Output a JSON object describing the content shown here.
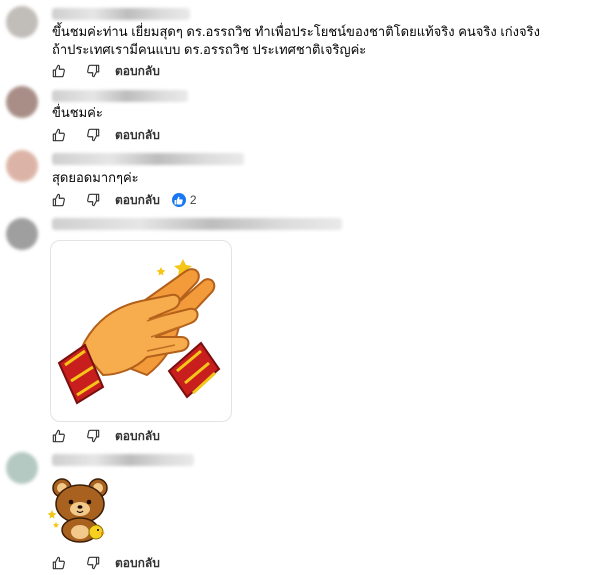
{
  "comments": [
    {
      "lines": [
        "ขึ้นชมค่ะท่าน เยี่ยมสุดๆ ดร.อรรถวิช ทำเพื่อประโยชน์ของชาติโดยแท้จริง คนจริง เก่งจริง",
        "ถ้าประเทศเรามีคนแบบ ดร.อรรถวิช ประเทศชาติเจริญค่ะ"
      ],
      "reply_label": "ตอบกลับ",
      "avatar_color": "#b7b2ad"
    },
    {
      "lines": [
        "ขื่นชมค่ะ"
      ],
      "reply_label": "ตอบกลับ",
      "avatar_color": "#9a7b72"
    },
    {
      "lines": [
        "สุดยอดมากๆค่ะ"
      ],
      "reply_label": "ตอบกลับ",
      "reaction_count": "2",
      "avatar_color": "#d7a898"
    },
    {
      "sticker": "clapping-hands-sticker",
      "reply_label": "ตอบกลับ",
      "avatar_color": "#8f8f8f"
    },
    {
      "sticker": "bear-sticker",
      "reply_label": "ตอบกลับ",
      "avatar_color": "#a8c0b8"
    }
  ],
  "colors": {
    "reaction_blue": "#1877f2",
    "text": "#050505",
    "sticker_orange": "#f0952e",
    "sticker_red": "#c81e1e"
  }
}
